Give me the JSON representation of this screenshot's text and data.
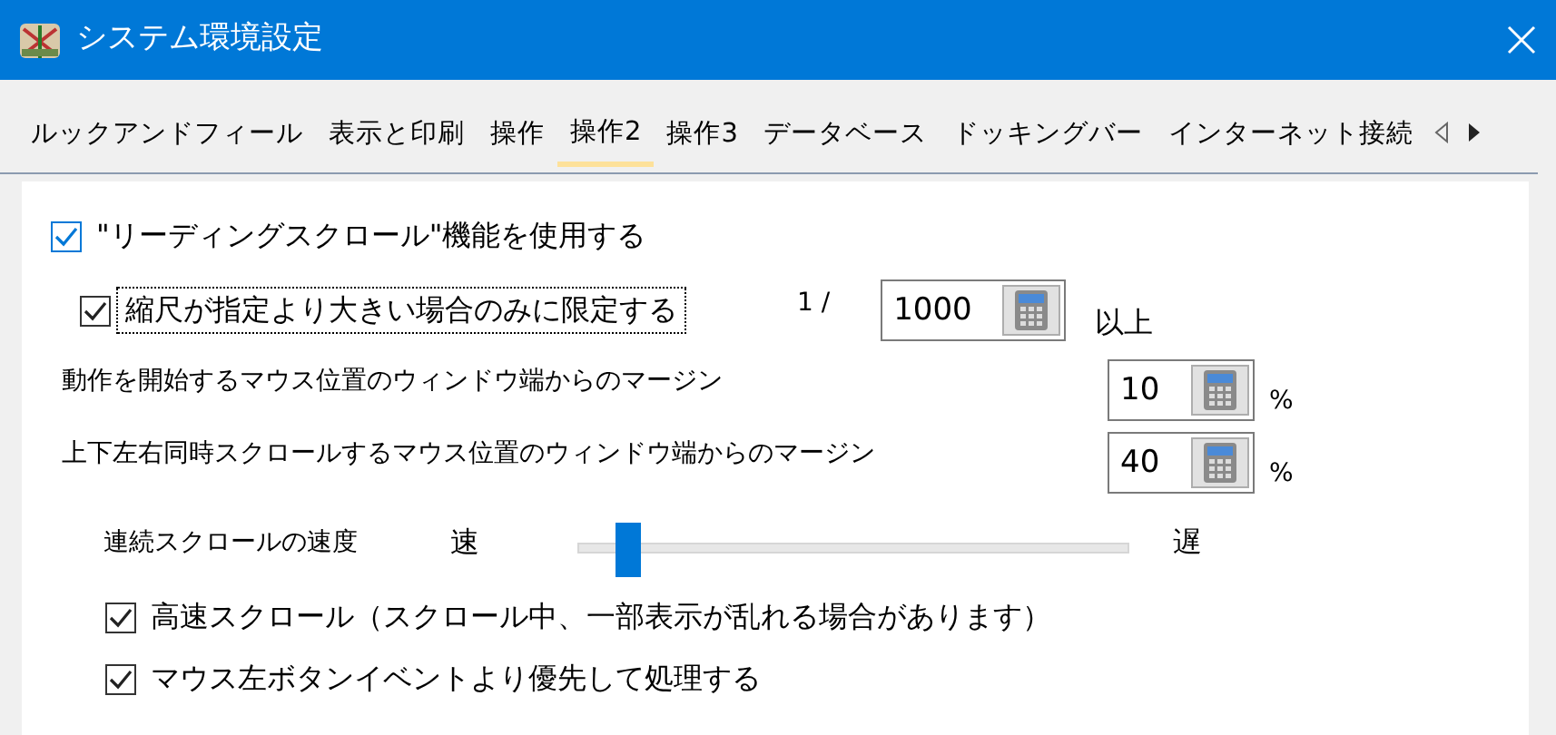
{
  "window": {
    "title": "システム環境設定"
  },
  "tabs": [
    {
      "label": "ルックアンドフィール",
      "selected": false
    },
    {
      "label": "表示と印刷",
      "selected": false
    },
    {
      "label": "操作",
      "selected": false
    },
    {
      "label": "操作2",
      "selected": true
    },
    {
      "label": "操作3",
      "selected": false
    },
    {
      "label": "データベース",
      "selected": false
    },
    {
      "label": "ドッキングバー",
      "selected": false
    },
    {
      "label": "インターネット接続",
      "selected": false
    }
  ],
  "reading_scroll": {
    "label": "\"リーディングスクロール\"機能を使用する",
    "checked": true,
    "highlighted": true
  },
  "scale_limit": {
    "label": "縮尺が指定より大きい場合のみに限定する",
    "checked": true,
    "focused": true,
    "prefix": "1 /",
    "value": "1000",
    "suffix": "以上"
  },
  "margins": [
    {
      "label": "動作を開始するマウス位置のウィンドウ端からのマージン",
      "value": "10",
      "unit": "%"
    },
    {
      "label": "上下左右同時スクロールするマウス位置のウィンドウ端からのマージン",
      "value": "40",
      "unit": "%"
    }
  ],
  "speed": {
    "label": "連続スクロールの速度",
    "min_label": "速",
    "max_label": "遅",
    "level": 0.07
  },
  "options": [
    {
      "label": "高速スクロール（スクロール中、一部表示が乱れる場合があります）",
      "checked": true
    },
    {
      "label": "マウス左ボタンイベントより優先して処理する",
      "checked": true
    }
  ]
}
